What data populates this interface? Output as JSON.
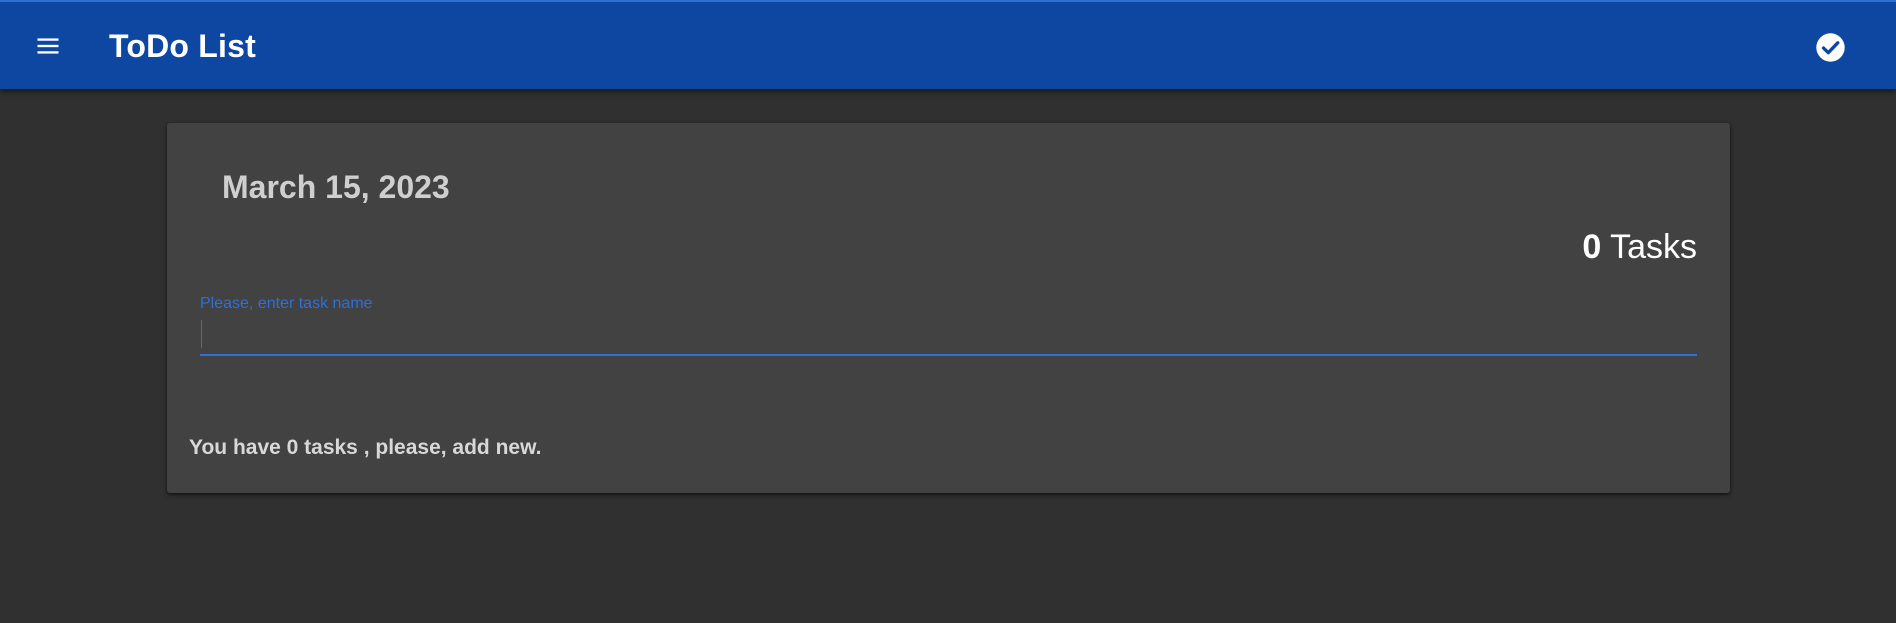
{
  "app_bar": {
    "title": "ToDo List",
    "menu_icon": "menu-icon",
    "action_icon": "check-circle-icon",
    "background_color": "#0d47a1"
  },
  "card": {
    "date": "March 15, 2023",
    "task_count": {
      "number": "0",
      "label": " Tasks"
    },
    "task_input": {
      "label": "Please, enter task name",
      "value": ""
    },
    "empty_message": "You have 0 tasks , please, add new."
  },
  "colors": {
    "page_background": "#303030",
    "card_background": "#424242",
    "accent": "#2f6fd6"
  }
}
